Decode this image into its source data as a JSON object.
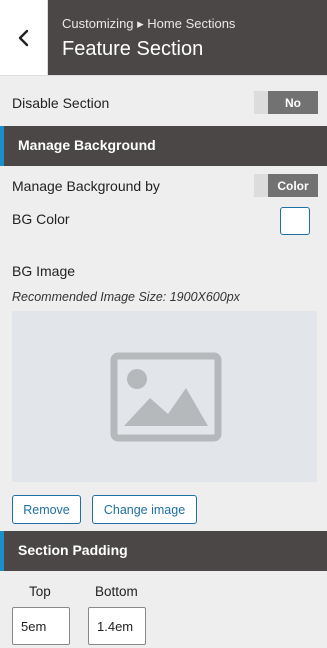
{
  "header": {
    "breadcrumb": "Customizing ▸ Home Sections",
    "title": "Feature Section",
    "back_icon": "chevron-left-icon"
  },
  "disable_section": {
    "label": "Disable Section",
    "toggle_value": "No"
  },
  "manage_background_section": {
    "title": "Manage Background"
  },
  "manage_background_by": {
    "label": "Manage Background by",
    "toggle_value": "Color"
  },
  "bg_color": {
    "label": "BG Color",
    "value": "#ffffff"
  },
  "bg_image": {
    "label": "BG Image",
    "hint": "Recommended Image Size: 1900X600px",
    "placeholder_icon": "image-placeholder-icon",
    "remove_label": "Remove",
    "change_label": "Change image"
  },
  "section_padding": {
    "title": "Section Padding",
    "top_label": "Top",
    "top_value": "5em",
    "bottom_label": "Bottom",
    "bottom_value": "1.4em"
  },
  "colors": {
    "header_bg": "#4a4746",
    "accent": "#1a8fc9",
    "link": "#1e6fa3"
  }
}
